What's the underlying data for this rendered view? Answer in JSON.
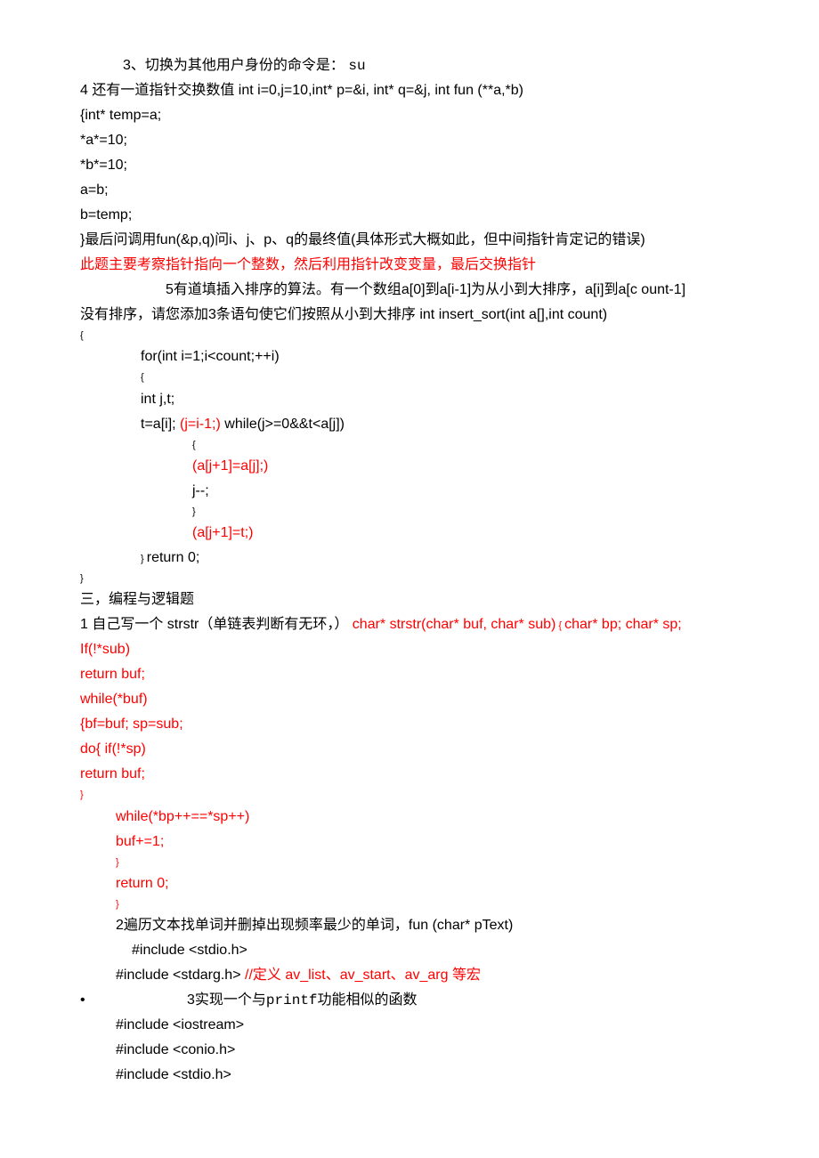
{
  "l1": {
    "prefix": "3、切换为其他用户身份的命令是：  ",
    "cmd": "su"
  },
  "l2": "4 还有一道指针交换数值  int i=0,j=10,int* p=&i, int* q=&j, int fun (**a,*b)",
  "l3": "{int* temp=a;",
  "l4": "*a*=10;",
  "l5": "*b*=10;",
  "l6": "a=b;",
  "l7": "b=temp;",
  "l8": "}最后问调用fun(&p,q)问i、j、p、q的最终值(具体形式大概如此，但中间指针肯定记的错误)",
  "l9": "此题主要考察指针指向一个整数，然后利用指针改变变量，最后交换指针",
  "l10": "5有道填插入排序的算法。有一个数组a[0]到a[i-1]为从小到大排序，a[i]到a[c ount-1]",
  "l11": "没有排序，请您添加3条语句使它们按照从小到大排序  int insert_sort(int a[],int count)",
  "l12": "{",
  "l13": "for(int i=1;i<count;++i)",
  "l14": "{",
  "l15": "int j,t;",
  "l16_a": "t=a[i]; ",
  "l16_b": "(j=i-1;)",
  "l16_c": " while(j>=0&&t<a[j])",
  "l17": "{",
  "l18": "(a[j+1]=a[j];)",
  "l19": "j--;",
  "l20": "}",
  "l21": "(a[j+1]=t;)",
  "l22_a": "} ",
  "l22_b": "return 0;",
  "l23": "}",
  "l24": "三，编程与逻辑题",
  "l25_a": "1 自己写一个  strstr（单链表判断有无环，） ",
  "l25_b": "char* strstr(char* buf, char* sub)",
  "l25_c": " { ",
  "l25_d": "char* bp; char* sp;",
  "l26": "If(!*sub)",
  "l27": "return buf;",
  "l28": "while(*buf)",
  "l29": "{bf=buf; sp=sub;",
  "l30": "do{ if(!*sp)",
  "l31": "return buf;",
  "l32": "}",
  "l33": "while(*bp++==*sp++)",
  "l34": "buf+=1;",
  "l35": "}",
  "l36": "return 0;",
  "l37": "}",
  "l38": "2遍历文本找单词并删掉出现频率最少的单词，fun (char* pText)",
  "l39": "#include <stdio.h>",
  "l40_a": "#include <stdarg.h> ",
  "l40_b": "//定义  av_list、av_start、av_arg 等宏",
  "l41_a": "•",
  "l41_b": "3实现一个与printf功能相似的函数",
  "l42": "#include <iostream>",
  "l43": "#include <conio.h>",
  "l44": "#include <stdio.h>"
}
